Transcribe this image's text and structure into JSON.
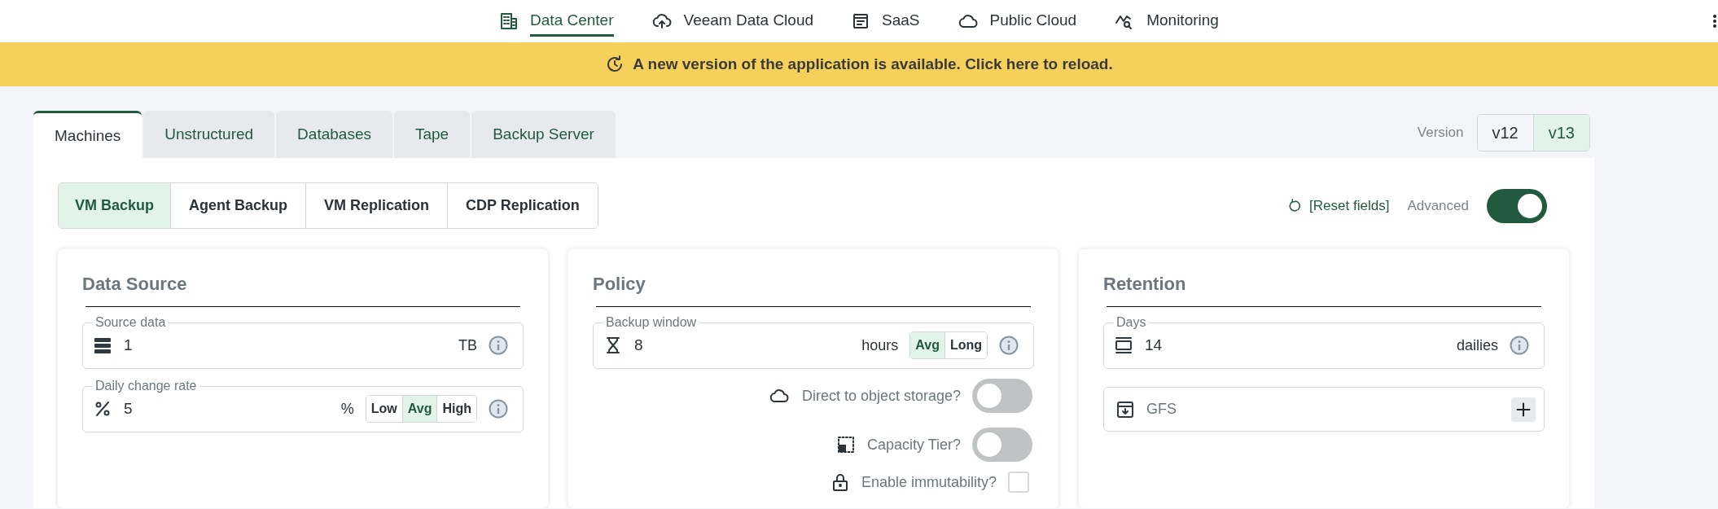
{
  "top_nav": {
    "items": [
      {
        "label": "Data Center",
        "selected": true
      },
      {
        "label": "Veeam Data Cloud",
        "selected": false
      },
      {
        "label": "SaaS",
        "selected": false
      },
      {
        "label": "Public Cloud",
        "selected": false
      },
      {
        "label": "Monitoring",
        "selected": false
      }
    ]
  },
  "banner": {
    "text": "A new version of the application is available. Click here to reload."
  },
  "tabs": [
    {
      "label": "Machines",
      "selected": true
    },
    {
      "label": "Unstructured",
      "selected": false
    },
    {
      "label": "Databases",
      "selected": false
    },
    {
      "label": "Tape",
      "selected": false
    },
    {
      "label": "Backup Server",
      "selected": false
    }
  ],
  "version": {
    "label": "Version",
    "options": [
      {
        "label": "v12",
        "selected": false
      },
      {
        "label": "v13",
        "selected": true
      }
    ]
  },
  "subtabs": [
    {
      "label": "VM Backup",
      "selected": true
    },
    {
      "label": "Agent Backup",
      "selected": false
    },
    {
      "label": "VM Replication",
      "selected": false
    },
    {
      "label": "CDP Replication",
      "selected": false
    }
  ],
  "reset_link": "[Reset fields]",
  "advanced": {
    "label": "Advanced",
    "on": true
  },
  "cards": [
    {
      "title": "Data Source",
      "fields": [
        {
          "kind": "input",
          "label": "Source data",
          "value": "1",
          "unit": "TB"
        },
        {
          "kind": "input",
          "label": "Daily change rate",
          "value": "5",
          "unit": "%",
          "options": [
            {
              "label": "Low",
              "selected": false
            },
            {
              "label": "Avg",
              "selected": true
            },
            {
              "label": "High",
              "selected": false
            }
          ]
        }
      ]
    },
    {
      "title": "Policy",
      "fields": [
        {
          "kind": "input",
          "label": "Backup window",
          "value": "8",
          "unit": "hours",
          "options": [
            {
              "label": "Avg",
              "selected": true
            },
            {
              "label": "Long",
              "selected": false
            }
          ]
        },
        {
          "kind": "toggle",
          "label": "Direct to object storage?",
          "on": false
        },
        {
          "kind": "toggle",
          "label": "Capacity Tier?",
          "on": false
        },
        {
          "kind": "checkbox",
          "label": "Enable immutability?",
          "checked": false
        }
      ]
    },
    {
      "title": "Retention",
      "fields": [
        {
          "kind": "input",
          "label": "Days",
          "value": "14",
          "unit": "dailies"
        },
        {
          "kind": "add",
          "label": "GFS"
        }
      ]
    }
  ]
}
